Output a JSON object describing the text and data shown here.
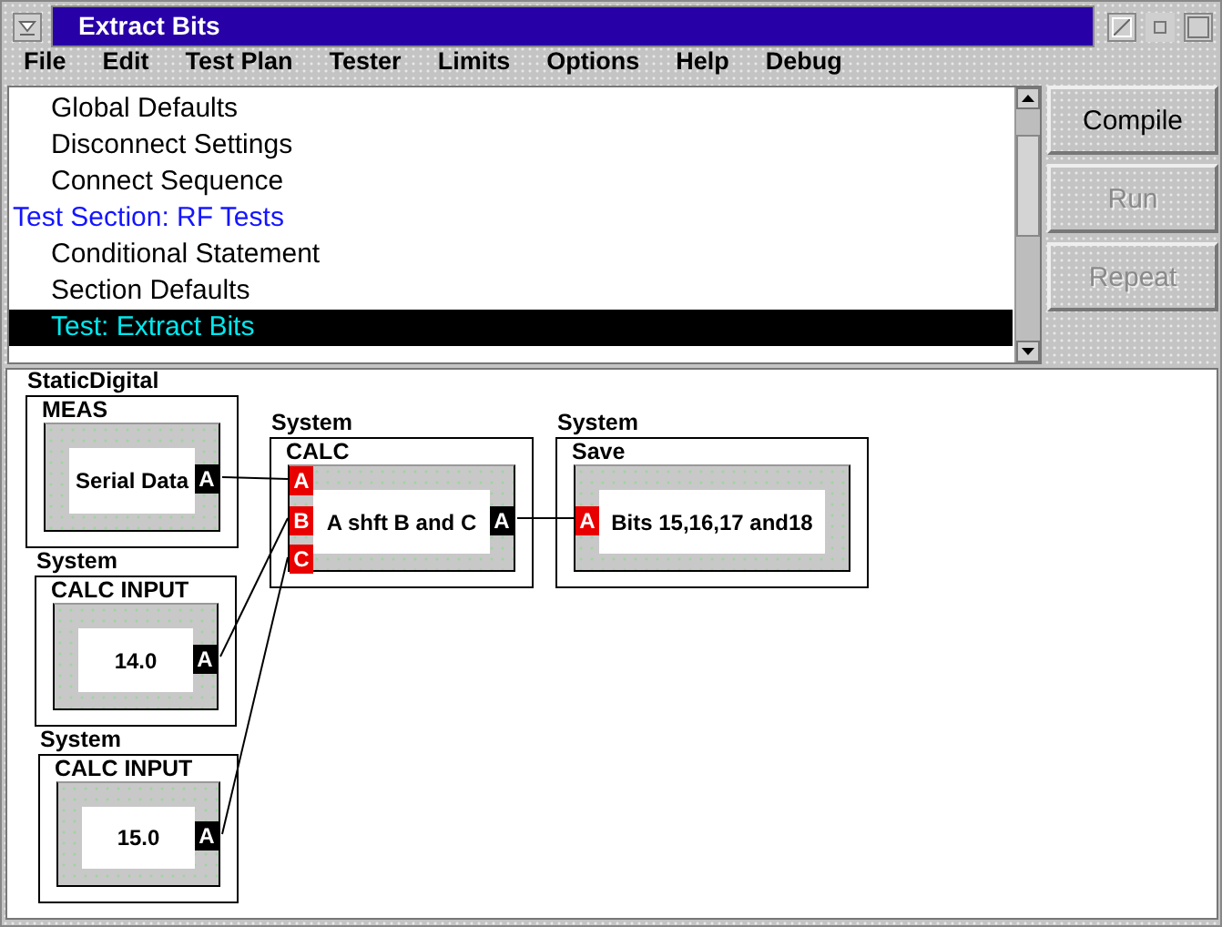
{
  "window": {
    "title": "Extract Bits"
  },
  "menu": [
    "File",
    "Edit",
    "Test Plan",
    "Tester",
    "Limits",
    "Options",
    "Help",
    "Debug"
  ],
  "tree": [
    {
      "label": "Global Defaults",
      "kind": "item",
      "selected": false
    },
    {
      "label": "Disconnect Settings",
      "kind": "item",
      "selected": false
    },
    {
      "label": "Connect Sequence",
      "kind": "item",
      "selected": false
    },
    {
      "label": "Test Section: RF Tests",
      "kind": "section",
      "selected": false
    },
    {
      "label": "Conditional Statement",
      "kind": "item",
      "selected": false
    },
    {
      "label": "Section Defaults",
      "kind": "item",
      "selected": false
    },
    {
      "label": "Test: Extract Bits",
      "kind": "item",
      "selected": true
    }
  ],
  "buttons": [
    {
      "label": "Compile",
      "disabled": false
    },
    {
      "label": "Run",
      "disabled": true
    },
    {
      "label": "Repeat",
      "disabled": true
    }
  ],
  "diagram": {
    "nodes": [
      {
        "group": "StaticDigital",
        "title": "MEAS",
        "text": "Serial Data",
        "outputs": [
          "A"
        ]
      },
      {
        "group": "System",
        "title": "CALC",
        "text": "A shft B and C",
        "inputs": [
          "A",
          "B",
          "C"
        ],
        "outputs": [
          "A"
        ]
      },
      {
        "group": "System",
        "title": "Save",
        "text": "Bits 15,16,17 and18",
        "inputs": [
          "A"
        ]
      },
      {
        "group": "System",
        "title": "CALC INPUT",
        "text": "14.0",
        "outputs": [
          "A"
        ]
      },
      {
        "group": "System",
        "title": "CALC INPUT",
        "text": "15.0",
        "outputs": [
          "A"
        ]
      }
    ]
  }
}
